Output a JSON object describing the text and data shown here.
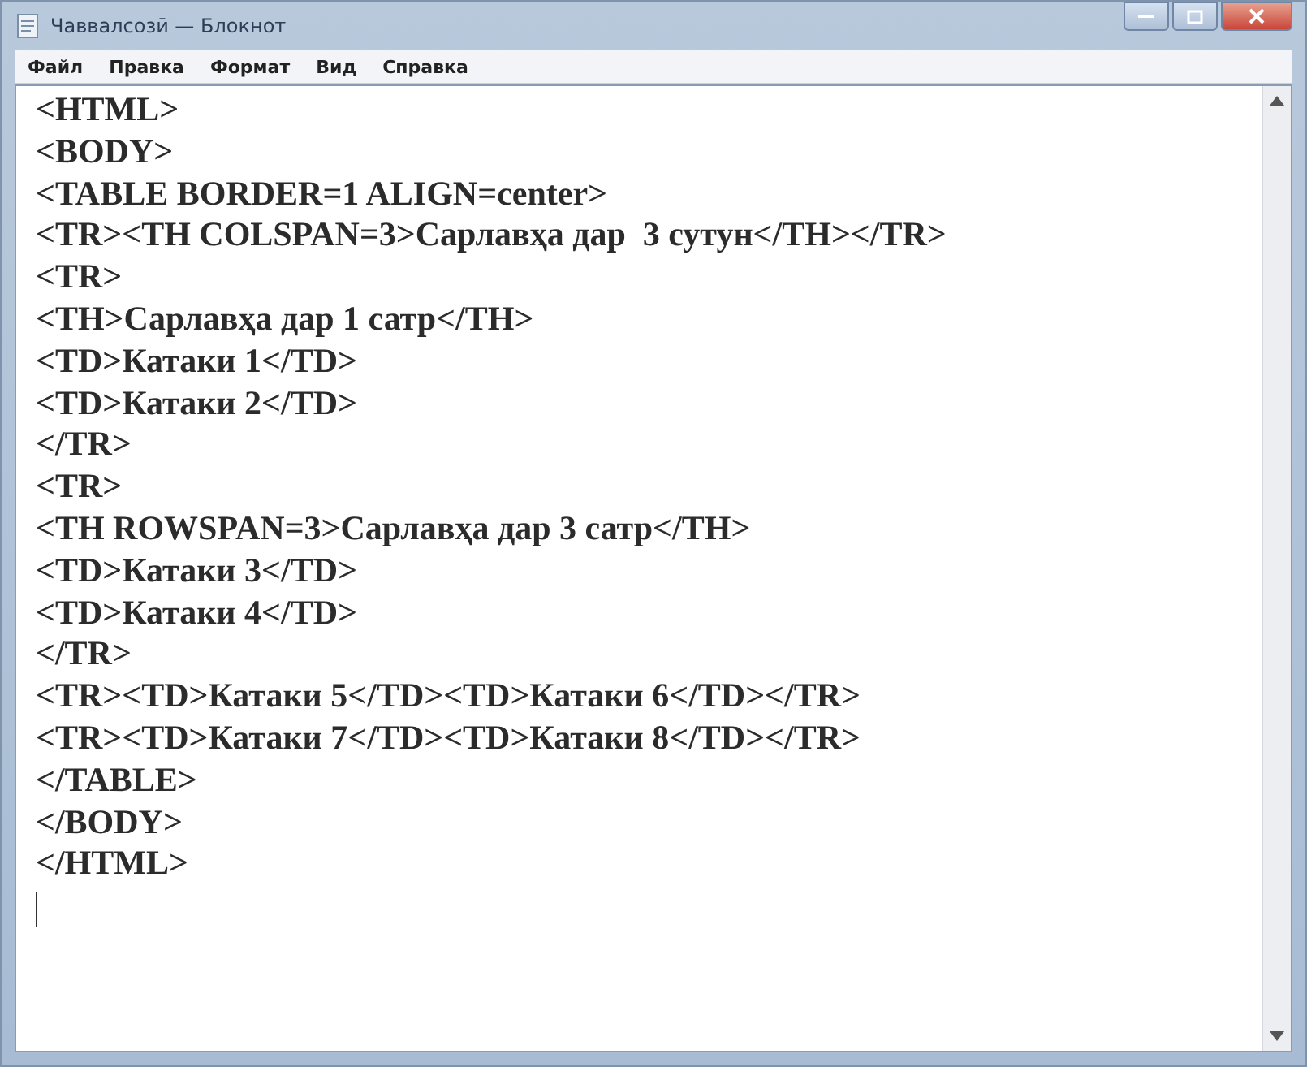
{
  "window": {
    "title": "Чаввалсозӣ — Блокнот"
  },
  "menu": [
    "Файл",
    "Правка",
    "Формат",
    "Вид",
    "Справка"
  ],
  "editor": {
    "lines": [
      "<HTML>",
      "<BODY>",
      "<TABLE BORDER=1 ALIGN=center>",
      "<TR><TH COLSPAN=3>Сарлавҳа дар  3 сутун</TH></TR>",
      "<TR>",
      "<TH>Сарлавҳа дар 1 сатр</TH>",
      "<TD>Катаки 1</TD>",
      "<TD>Катаки 2</TD>",
      "</TR>",
      "<TR>",
      "<TH ROWSPAN=3>Сарлавҳа дар 3 сатр</TH>",
      "<TD>Катаки 3</TD>",
      "<TD>Катаки 4</TD>",
      "</TR>",
      "<TR><TD>Катаки 5</TD><TD>Катаки 6</TD></TR>",
      "<TR><TD>Катаки 7</TD><TD>Катаки 8</TD></TR>",
      "</TABLE>",
      "</BODY>",
      "</HTML>"
    ]
  }
}
